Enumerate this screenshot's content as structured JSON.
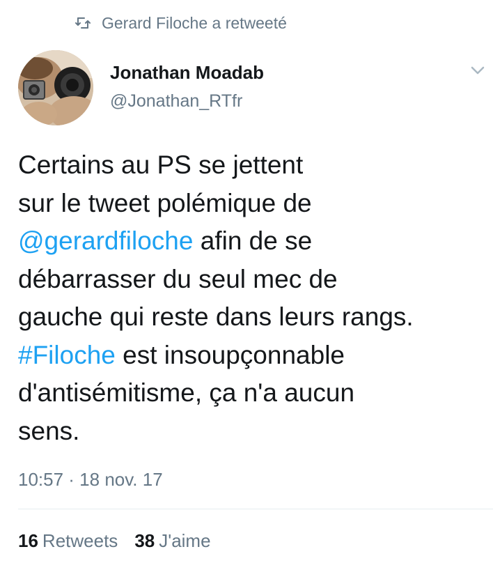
{
  "retweet_header": {
    "icon": "retweet-icon",
    "text": "Gerard Filoche a retweeté"
  },
  "author": {
    "name": "Jonathan Moadab",
    "handle": "@Jonathan_RTfr",
    "avatar_icon": "avatar-photo"
  },
  "menu": {
    "icon": "chevron-down-icon"
  },
  "tweet": {
    "lines": [
      [
        {
          "text": "Certains au PS se jettent",
          "type": "text"
        }
      ],
      [
        {
          "text": "sur le tweet polémique de",
          "type": "text"
        }
      ],
      [
        {
          "text": "@gerardfiloche",
          "type": "mention"
        },
        {
          "text": " afin de se",
          "type": "text"
        }
      ],
      [
        {
          "text": "débarrasser du seul mec de",
          "type": "text"
        }
      ],
      [
        {
          "text": "gauche qui reste dans leurs rangs.",
          "type": "text"
        }
      ],
      [
        {
          "text": "#Filoche",
          "type": "hashtag"
        },
        {
          "text": " est insoupçonnable",
          "type": "text"
        }
      ],
      [
        {
          "text": "d'antisémitisme, ça n'a aucun",
          "type": "text"
        }
      ],
      [
        {
          "text": "sens.",
          "type": "text"
        }
      ]
    ]
  },
  "timestamp": "10:57 · 18 nov. 17",
  "stats": {
    "retweets": {
      "count": "16",
      "label": "Retweets"
    },
    "likes": {
      "count": "38",
      "label": "J'aime"
    }
  },
  "colors": {
    "link": "#1da1f2",
    "secondary_text": "#657786",
    "primary_text": "#14171a",
    "divider": "#e6ecf0"
  }
}
